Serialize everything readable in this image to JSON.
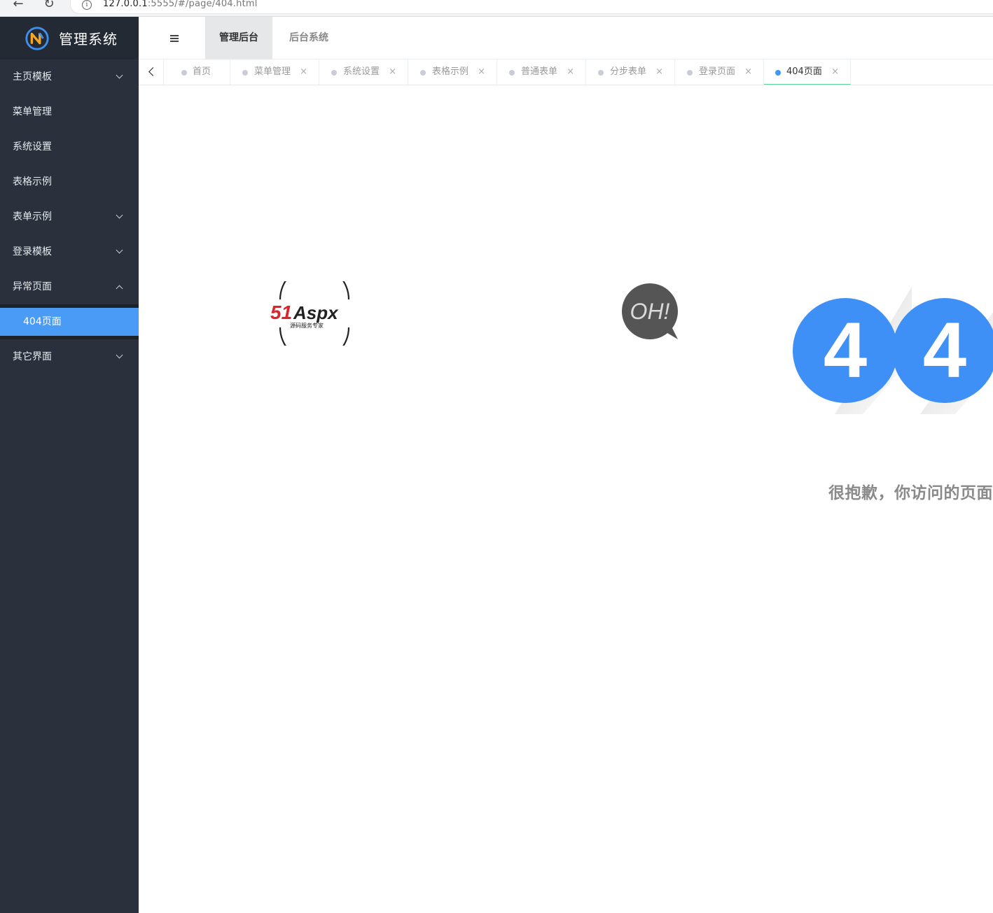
{
  "browser": {
    "url_host": "127.0.0.1",
    "url_rest": ":5555/#/page/404.html",
    "back_glyph": "←",
    "reload_glyph": "↻",
    "info_glyph": "i"
  },
  "app": {
    "title": "管理系统"
  },
  "sidebar": {
    "items": [
      {
        "label": "主页模板",
        "chevron": "down"
      },
      {
        "label": "菜单管理"
      },
      {
        "label": "系统设置"
      },
      {
        "label": "表格示例"
      },
      {
        "label": "表单示例",
        "chevron": "down"
      },
      {
        "label": "登录模板",
        "chevron": "down"
      },
      {
        "label": "异常页面",
        "chevron": "up"
      },
      {
        "label": "其它界面",
        "chevron": "down"
      }
    ],
    "submenu": {
      "active_label": "404页面"
    }
  },
  "topbar": {
    "tabs": [
      {
        "label": "管理后台",
        "active": true
      },
      {
        "label": "后台系统",
        "active": false
      }
    ]
  },
  "tabbar": {
    "close_glyph": "×",
    "tabs": [
      {
        "label": "首页",
        "closable": false
      },
      {
        "label": "菜单管理",
        "closable": true
      },
      {
        "label": "系统设置",
        "closable": true
      },
      {
        "label": "表格示例",
        "closable": true
      },
      {
        "label": "普通表单",
        "closable": true
      },
      {
        "label": "分步表单",
        "closable": true
      },
      {
        "label": "登录页面",
        "closable": true
      },
      {
        "label": "404页面",
        "closable": true,
        "current": true
      }
    ]
  },
  "content": {
    "brand_logo_text": "51Aspx",
    "brand_logo_subtext": "源码服务专家",
    "bubble_text": "OH!",
    "digits": [
      "4",
      "4"
    ],
    "message": "很抱歉，你访问的页面"
  },
  "colors": {
    "sidebar_bg": "#2a313d",
    "accent_blue": "#4a9bf6",
    "digit_blue": "#3f90f6",
    "active_tab_underline": "#5fd19a"
  }
}
